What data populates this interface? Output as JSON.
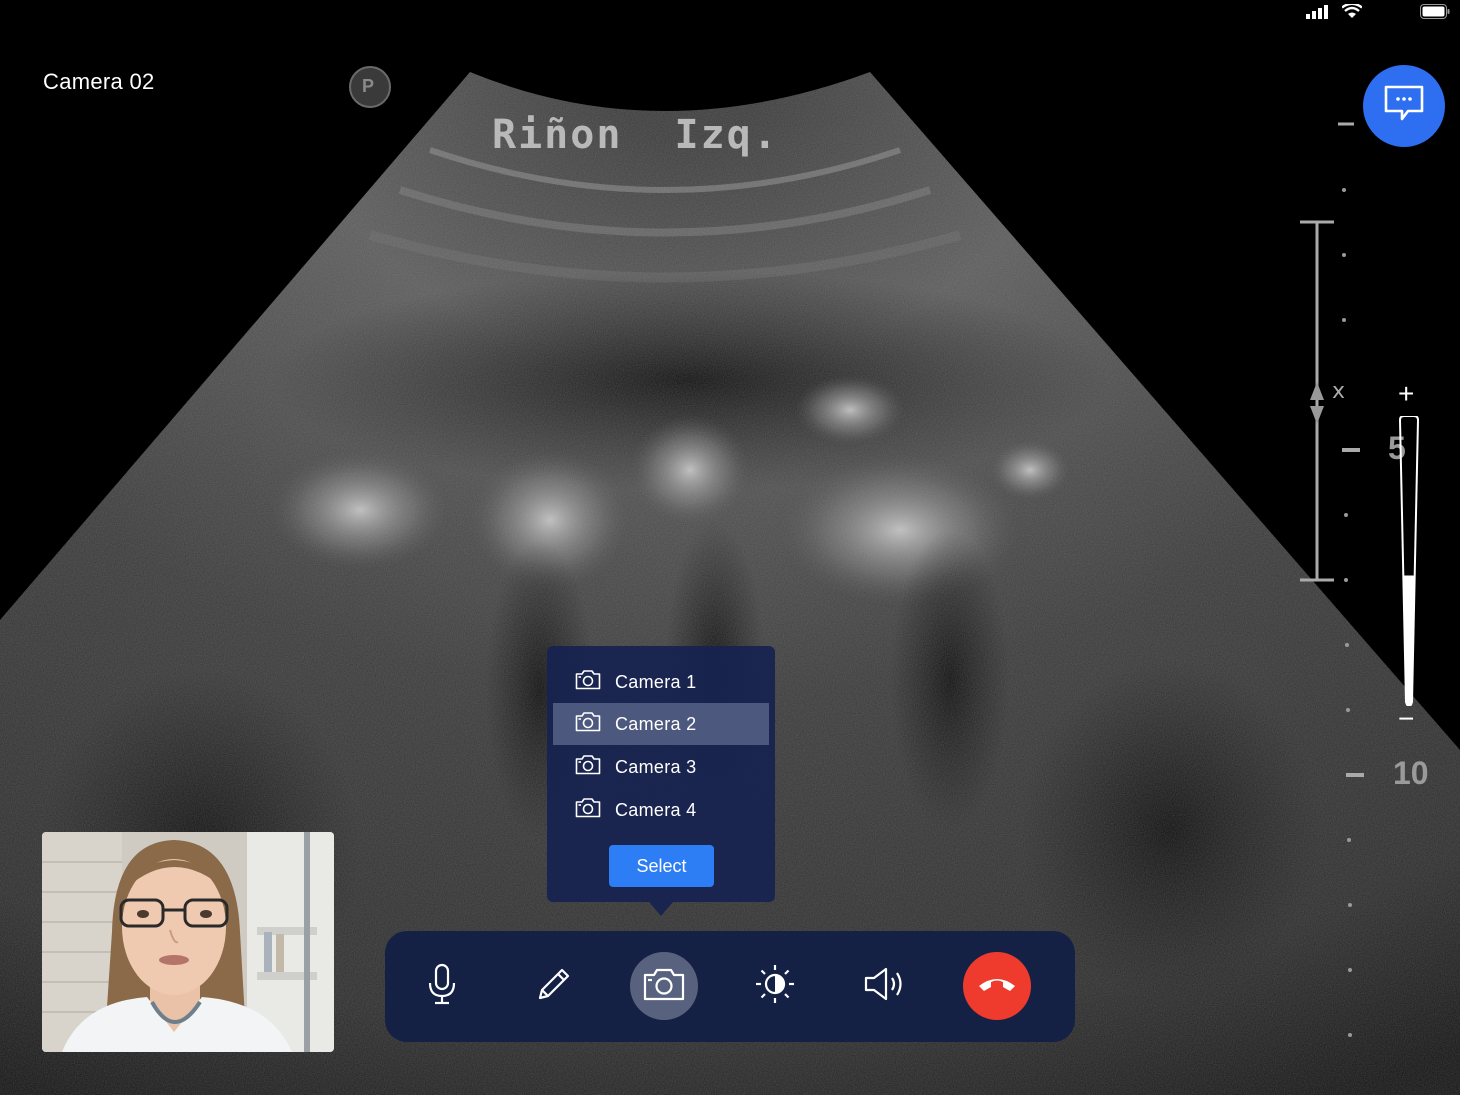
{
  "status_bar": {
    "icons": [
      "signal-icon",
      "wifi-icon",
      "battery-icon"
    ]
  },
  "feed": {
    "camera_label": "Camera 02",
    "overlay_text": "Riñon Izq.",
    "probe_marker": "P",
    "depth_labels": {
      "mid": "5",
      "deep": "10"
    }
  },
  "chat": {
    "icon": "chat-bubble-icon"
  },
  "zoom": {
    "plus": "+",
    "minus": "−",
    "level": 0.45
  },
  "camera_menu": {
    "options": [
      {
        "label": "Camera 1",
        "icon": "camera-icon"
      },
      {
        "label": "Camera 2",
        "icon": "camera-icon"
      },
      {
        "label": "Camera 3",
        "icon": "camera-icon"
      },
      {
        "label": "Camera 4",
        "icon": "camera-icon"
      }
    ],
    "selected_index": 1,
    "select_label": "Select"
  },
  "toolbar": {
    "buttons": [
      "microphone-icon",
      "pencil-icon",
      "camera-icon",
      "brightness-icon",
      "speaker-icon",
      "end-call-icon"
    ],
    "active": "camera-icon"
  },
  "colors": {
    "accent": "#2d6ff0",
    "toolbar_bg": "#121e46",
    "end_call": "#ef3b2d",
    "popover_selected": "#4d587e"
  }
}
